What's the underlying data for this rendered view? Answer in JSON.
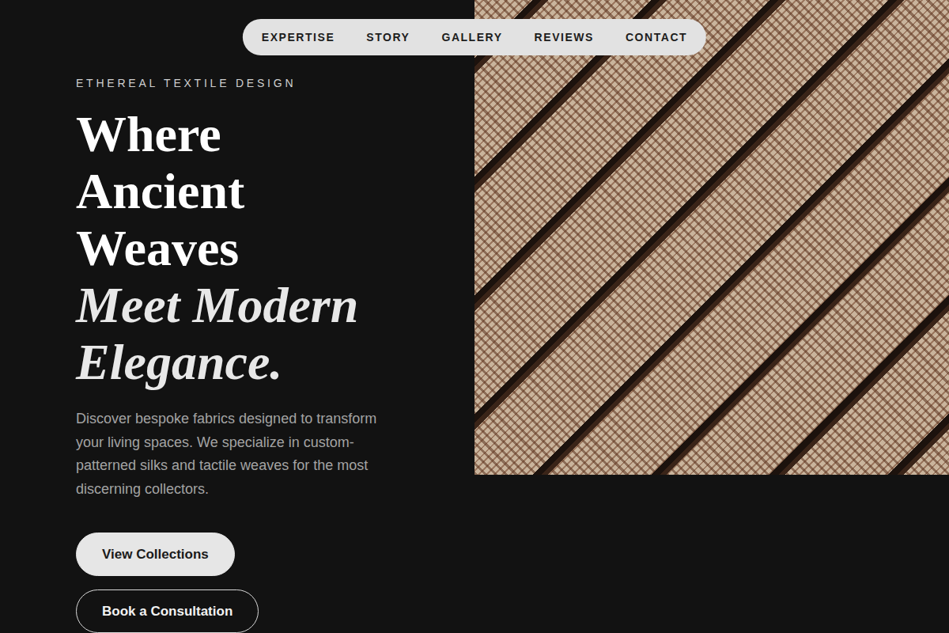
{
  "nav": {
    "items": [
      "EXPERTISE",
      "STORY",
      "GALLERY",
      "REVIEWS",
      "CONTACT"
    ]
  },
  "eyebrow": "ETHEREAL TEXTILE DESIGN",
  "headline": [
    {
      "text": "Where",
      "italic": false
    },
    {
      "text": "Ancient",
      "italic": false
    },
    {
      "text": "Weaves",
      "italic": false
    },
    {
      "text": "Meet Modern",
      "italic": true
    },
    {
      "text": "Elegance.",
      "italic": true
    }
  ],
  "description": "Discover bespoke fabrics designed to transform your living spaces. We specialize in custom-patterned silks and tactile weaves for the most discerning collectors.",
  "buttons": [
    {
      "label": "View Collections",
      "kind": "filled"
    },
    {
      "label": "Book a Consultation",
      "kind": "outline"
    }
  ]
}
